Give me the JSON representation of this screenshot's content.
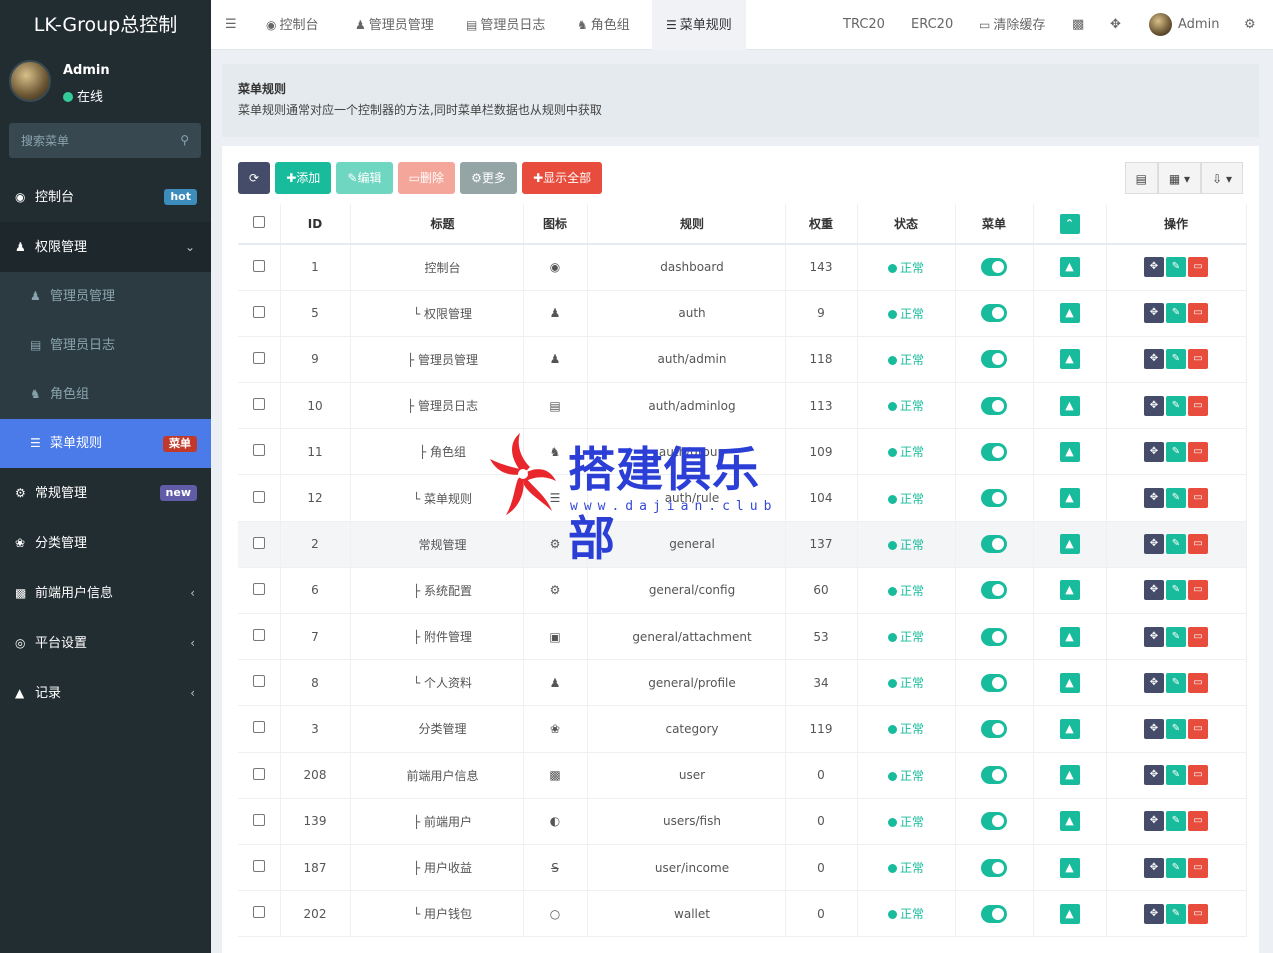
{
  "brand": "LK-Group总控制",
  "user": {
    "name": "Admin",
    "status": "在线"
  },
  "search": {
    "placeholder": "搜索菜单"
  },
  "sidebar": {
    "items": [
      {
        "label": "控制台",
        "icon": "dashboard-icon",
        "badge": "hot",
        "badge_color": "#3c8dbc"
      },
      {
        "label": "权限管理",
        "icon": "users-icon",
        "expanded": true,
        "children": [
          {
            "label": "管理员管理",
            "icon": "user-icon"
          },
          {
            "label": "管理员日志",
            "icon": "list-alt-icon"
          },
          {
            "label": "角色组",
            "icon": "group-icon"
          },
          {
            "label": "菜单规则",
            "icon": "bars-icon",
            "badge": "菜单",
            "badge_color": "#c0392b",
            "active": true
          }
        ]
      },
      {
        "label": "常规管理",
        "icon": "cogs-icon",
        "badge": "new",
        "badge_color": "#605ca8"
      },
      {
        "label": "分类管理",
        "icon": "leaf-icon"
      },
      {
        "label": "前端用户信息",
        "icon": "user-card-icon"
      },
      {
        "label": "平台设置",
        "icon": "settings-icon"
      },
      {
        "label": "记录",
        "icon": "chart-icon"
      }
    ]
  },
  "topbar": {
    "tabs": [
      "控制台",
      "管理员管理",
      "管理员日志",
      "角色组",
      "菜单规则"
    ],
    "right": {
      "trc": "TRC20",
      "erc": "ERC20",
      "clear": "清除缓存",
      "admin": "Admin"
    }
  },
  "notice": {
    "title": "菜单规则",
    "desc": "菜单规则通常对应一个控制器的方法,同时菜单栏数据也从规则中获取"
  },
  "toolbar": {
    "add": "添加",
    "edit": "编辑",
    "delete": "删除",
    "more": "更多",
    "show_all": "显示全部"
  },
  "table": {
    "headers": {
      "id": "ID",
      "title": "标题",
      "icon": "图标",
      "rule": "规则",
      "weight": "权重",
      "status": "状态",
      "menu": "菜单",
      "ops": "操作"
    },
    "rows": [
      {
        "id": "1",
        "title": "控制台",
        "icon": "dashboard-icon",
        "rule": "dashboard",
        "weight": "143",
        "status": "正常"
      },
      {
        "id": "5",
        "title": "└ 权限管理",
        "icon": "users-icon",
        "rule": "auth",
        "weight": "9",
        "status": "正常"
      },
      {
        "id": "9",
        "title": "├ 管理员管理",
        "icon": "user-icon",
        "rule": "auth/admin",
        "weight": "118",
        "status": "正常"
      },
      {
        "id": "10",
        "title": "├ 管理员日志",
        "icon": "list-alt-icon",
        "rule": "auth/adminlog",
        "weight": "113",
        "status": "正常"
      },
      {
        "id": "11",
        "title": "├ 角色组",
        "icon": "group-icon",
        "rule": "auth/group",
        "weight": "109",
        "status": "正常"
      },
      {
        "id": "12",
        "title": "└ 菜单规则",
        "icon": "bars-icon",
        "rule": "auth/rule",
        "weight": "104",
        "status": "正常"
      },
      {
        "id": "2",
        "title": "常规管理",
        "icon": "cogs-icon",
        "rule": "general",
        "weight": "137",
        "status": "正常"
      },
      {
        "id": "6",
        "title": "├ 系统配置",
        "icon": "cog-icon",
        "rule": "general/config",
        "weight": "60",
        "status": "正常"
      },
      {
        "id": "7",
        "title": "├ 附件管理",
        "icon": "file-image-icon",
        "rule": "general/attachment",
        "weight": "53",
        "status": "正常"
      },
      {
        "id": "8",
        "title": "└ 个人资料",
        "icon": "user-icon",
        "rule": "general/profile",
        "weight": "34",
        "status": "正常"
      },
      {
        "id": "3",
        "title": "分类管理",
        "icon": "leaf-icon",
        "rule": "category",
        "weight": "119",
        "status": "正常"
      },
      {
        "id": "208",
        "title": "前端用户信息",
        "icon": "user-card-icon",
        "rule": "user",
        "weight": "0",
        "status": "正常"
      },
      {
        "id": "139",
        "title": "├ 前端用户",
        "icon": "user-circle-icon",
        "rule": "users/fish",
        "weight": "0",
        "status": "正常"
      },
      {
        "id": "187",
        "title": "├ 用户收益",
        "icon": "strikethrough-icon",
        "rule": "user/income",
        "weight": "0",
        "status": "正常"
      },
      {
        "id": "202",
        "title": "└ 用户钱包",
        "icon": "circle-icon",
        "rule": "wallet",
        "weight": "0",
        "status": "正常"
      }
    ]
  },
  "watermark": {
    "text": "搭建俱乐部",
    "url": "www.dajian.club"
  }
}
